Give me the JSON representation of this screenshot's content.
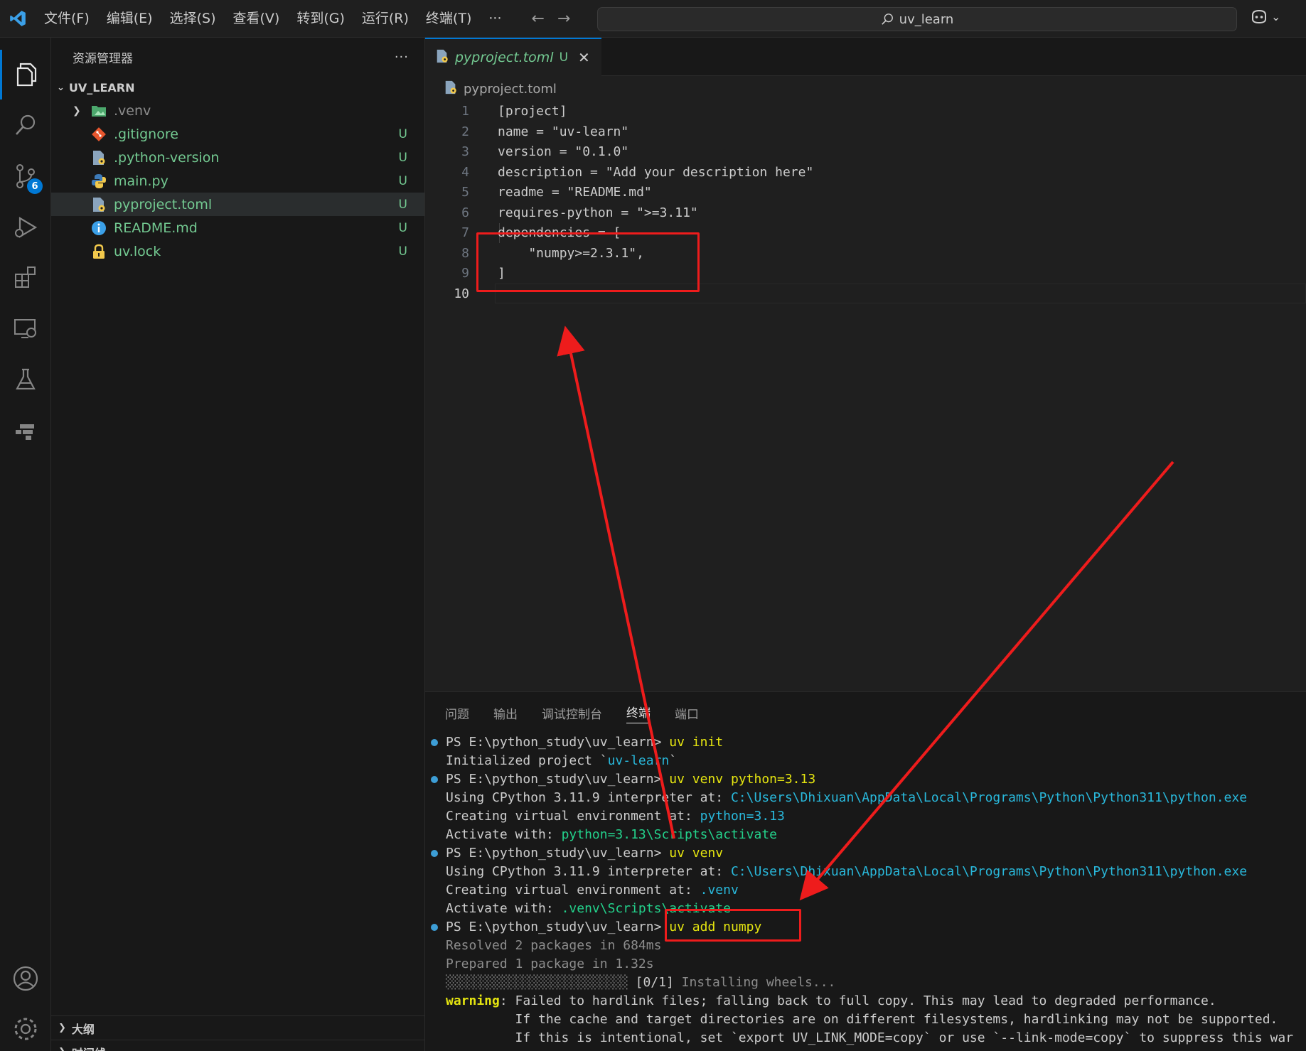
{
  "titlebar": {
    "menu": [
      "文件(F)",
      "编辑(E)",
      "选择(S)",
      "查看(V)",
      "转到(G)",
      "运行(R)",
      "终端(T)",
      "···"
    ],
    "back_arrow": "←",
    "forward_arrow": "→",
    "search_text": "uv_learn",
    "search_icon": "search-icon",
    "copilot_icon": "copilot-icon",
    "chevron": "⌄"
  },
  "activitybar": {
    "items": [
      "explorer-icon",
      "search-icon",
      "source-control-icon",
      "run-debug-icon",
      "extensions-icon",
      "remote-explorer-icon",
      "testing-icon",
      "docker-icon"
    ],
    "source_control_badge": "6",
    "bottom": [
      "account-icon",
      "settings-gear-icon"
    ]
  },
  "sidebar": {
    "title": "资源管理器",
    "more": "···",
    "root_folder": "UV_LEARN",
    "files": [
      {
        "name": ".venv",
        "icon": "folder-icon",
        "status": "",
        "kind": "folder"
      },
      {
        "name": ".gitignore",
        "icon": "git-icon",
        "status": "U",
        "kind": "file"
      },
      {
        "name": ".python-version",
        "icon": "settings-file-icon",
        "status": "U",
        "kind": "file"
      },
      {
        "name": "main.py",
        "icon": "python-icon",
        "status": "U",
        "kind": "file"
      },
      {
        "name": "pyproject.toml",
        "icon": "toml-icon",
        "status": "U",
        "kind": "file",
        "selected": true
      },
      {
        "name": "README.md",
        "icon": "info-icon",
        "status": "U",
        "kind": "file"
      },
      {
        "name": "uv.lock",
        "icon": "lock-icon",
        "status": "U",
        "kind": "file"
      }
    ],
    "outline": "大纲",
    "timeline": "时间线"
  },
  "editor": {
    "tab": {
      "name": "pyproject.toml",
      "status": "U",
      "close": "✕"
    },
    "breadcrumb": "pyproject.toml",
    "lines": [
      "[project]",
      "name = \"uv-learn\"",
      "version = \"0.1.0\"",
      "description = \"Add your description here\"",
      "readme = \"README.md\"",
      "requires-python = \">=3.11\"",
      "dependencies = [",
      "    \"numpy>=2.3.1\",",
      "]",
      ""
    ],
    "current_line": 10
  },
  "panel": {
    "tabs": [
      "问题",
      "输出",
      "调试控制台",
      "终端",
      "端口"
    ],
    "active_tab": "终端",
    "terminal": {
      "l1_prompt": "PS E:\\python_study\\uv_learn> ",
      "l1_cmd": "uv init",
      "l2_a": "Initialized project `",
      "l2_b": "uv-learn",
      "l2_c": "`",
      "l3_prompt": "PS E:\\python_study\\uv_learn> ",
      "l3_cmd": "uv venv python=3.13",
      "l4_a": "Using CPython 3.11.9 interpreter at: ",
      "l4_b": "C:\\Users\\Dhixuan\\AppData\\Local\\Programs\\Python\\Python311\\python.exe",
      "l5_a": "Creating virtual environment at: ",
      "l5_b": "python=3.13",
      "l6_a": "Activate with: ",
      "l6_b": "python=3.13\\Scripts\\activate",
      "l7_prompt": "PS E:\\python_study\\uv_learn> ",
      "l7_cmd": "uv venv",
      "l8_a": "Using CPython 3.11.9 interpreter at: ",
      "l8_b": "C:\\Users\\Dhixuan\\AppData\\Local\\Programs\\Python\\Python311\\python.exe",
      "l9_a": "Creating virtual environment at: ",
      "l9_b": ".venv",
      "l10_a": "Activate with: ",
      "l10_b": ".venv\\Scripts\\activate",
      "l11_prompt": "PS E:\\python_study\\uv_learn> ",
      "l11_cmd": "uv add numpy",
      "l12": "Resolved 2 packages in 684ms",
      "l13": "Prepared 1 package in 1.32s",
      "l14_bar": "░░░░░░░░░░░░░░░░░░░░░░░░░░",
      "l14_a": " [0/1]",
      "l14_b": " Installing wheels...",
      "l15_a": "warning",
      "l15_b": ": Failed to hardlink files; falling back to full copy. This may lead to degraded performance.",
      "l16": "         If the cache and target directories are on different filesystems, hardlinking may not be supported.",
      "l17": "         If this is intentional, set `export UV_LINK_MODE=copy` or use `--link-mode=copy` to suppress this war"
    }
  },
  "colors": {
    "accent": "#0078d4",
    "annotation": "#ee1c1c",
    "untracked": "#73c991"
  }
}
